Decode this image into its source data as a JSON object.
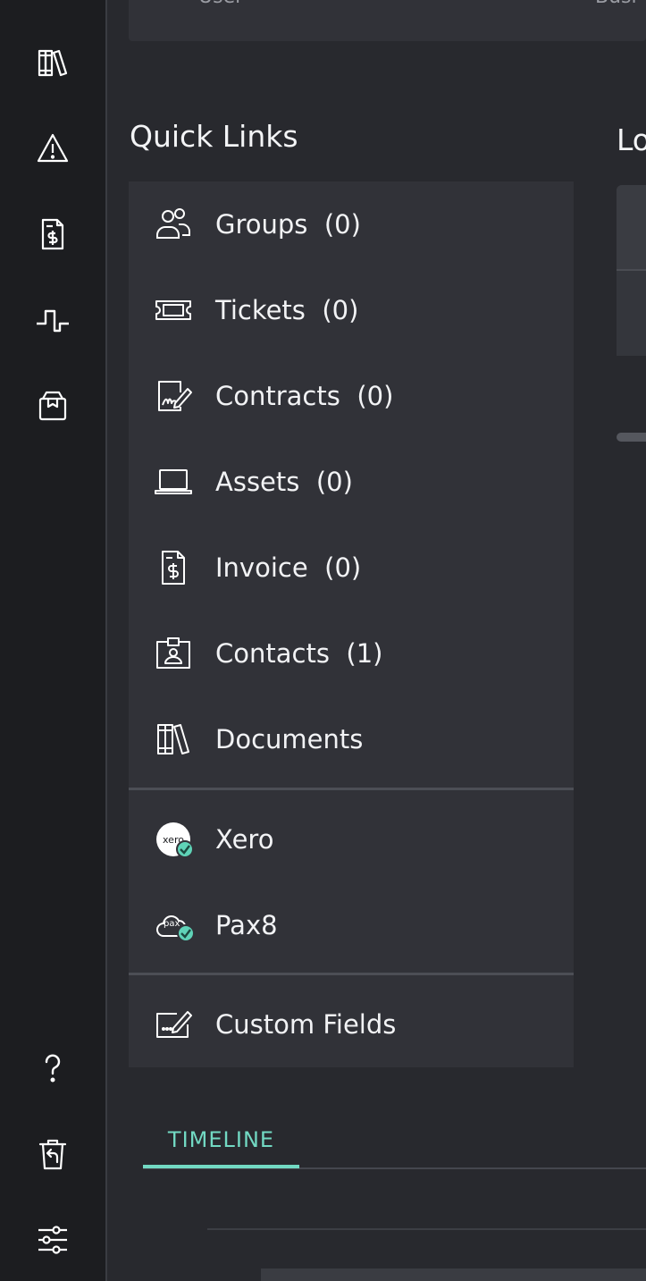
{
  "top_card": {
    "left_text": "User",
    "right_text": "Busi"
  },
  "quick_links": {
    "title": "Quick Links",
    "items": [
      {
        "label": "Groups",
        "count": "(0)",
        "icon": "groups-icon"
      },
      {
        "label": "Tickets",
        "count": "(0)",
        "icon": "ticket-icon"
      },
      {
        "label": "Contracts",
        "count": "(0)",
        "icon": "contract-icon"
      },
      {
        "label": "Assets",
        "count": "(0)",
        "icon": "laptop-icon"
      },
      {
        "label": "Invoice",
        "count": "(0)",
        "icon": "invoice-icon"
      },
      {
        "label": "Contacts",
        "count": "(1)",
        "icon": "contact-card-icon"
      },
      {
        "label": "Documents",
        "count": "",
        "icon": "books-icon"
      }
    ],
    "integrations": [
      {
        "label": "Xero",
        "icon": "xero-logo-icon",
        "logo_text": "xero"
      },
      {
        "label": "Pax8",
        "icon": "pax8-logo-icon",
        "logo_text": "pax"
      }
    ],
    "custom_fields": {
      "label": "Custom Fields",
      "icon": "edit-box-icon"
    }
  },
  "right_title": "Lo",
  "tabs": {
    "timeline": "TIMELINE"
  },
  "colors": {
    "accent": "#72d9c3",
    "badge": "#5fd3b7",
    "background": "#28292e",
    "card": "#313238",
    "rail": "#1c1d20"
  },
  "rail_icons": [
    "books-icon",
    "warning-icon",
    "invoice-icon",
    "pulse-icon",
    "box-icon",
    "help-icon",
    "restore-trash-icon",
    "settings-sliders-icon"
  ]
}
